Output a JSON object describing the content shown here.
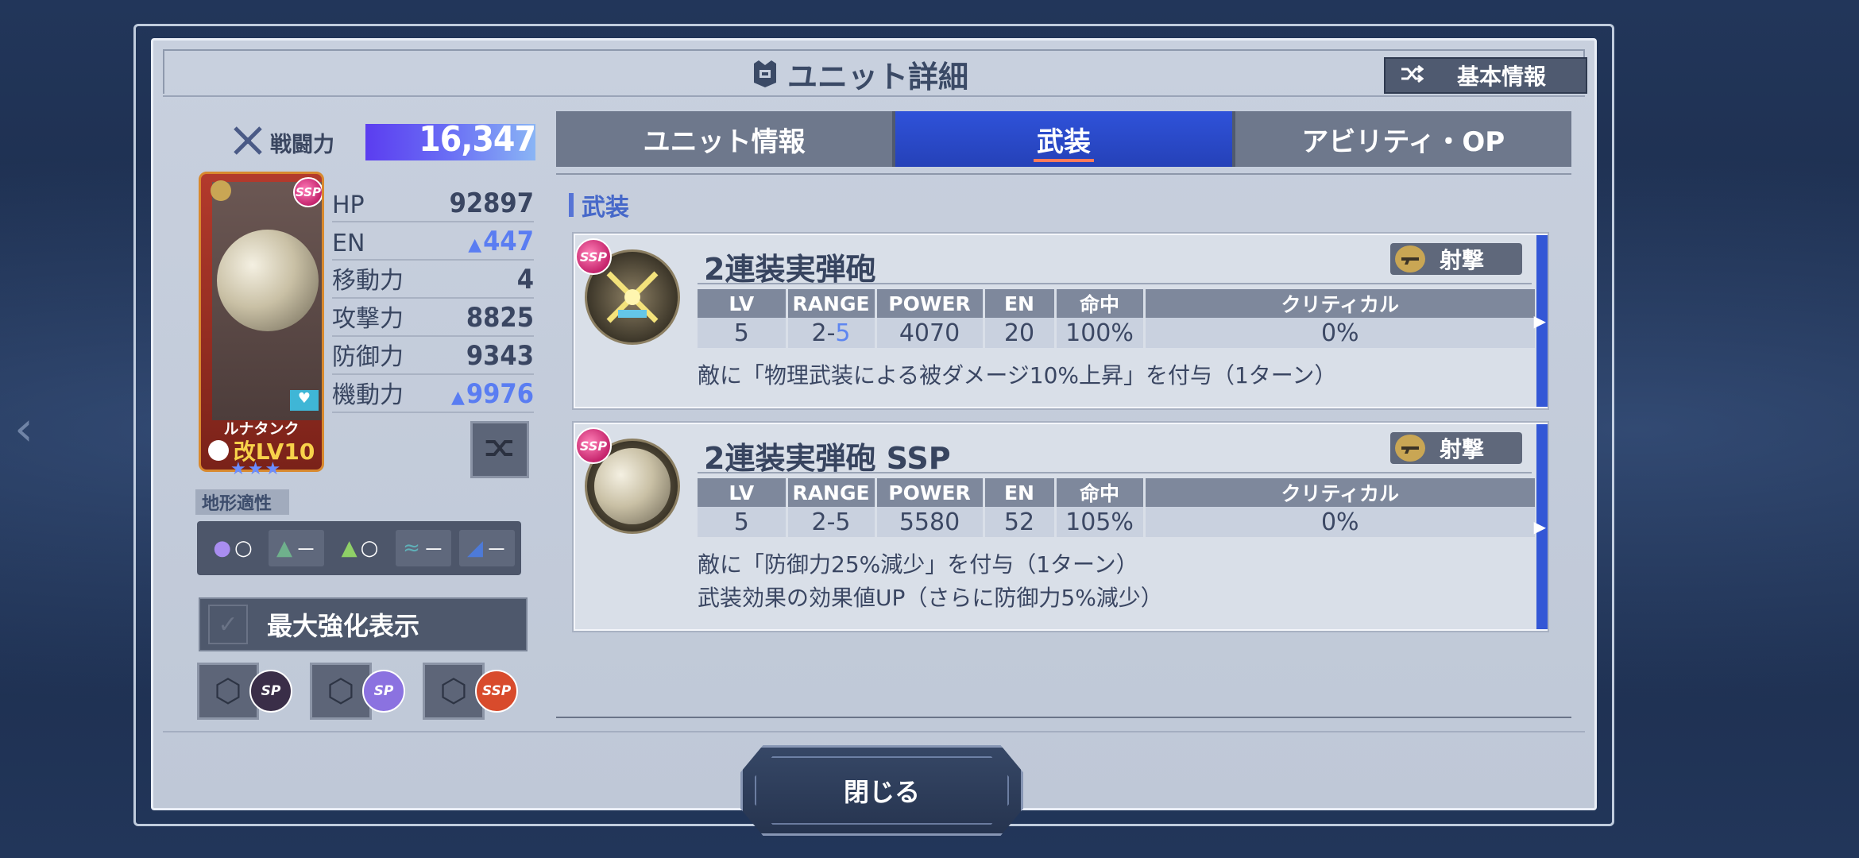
{
  "header": {
    "title": "ユニット詳細",
    "basic_info_label": "基本情報"
  },
  "power": {
    "label": "戦闘力",
    "value": "16,347"
  },
  "unit": {
    "name": "ルナタンク",
    "level": "改LV10",
    "rarity_badge": "SSP",
    "stars": "★★★"
  },
  "stats": [
    {
      "label": "HP",
      "value": "92897",
      "up": false
    },
    {
      "label": "EN",
      "value": "447",
      "up": true
    },
    {
      "label": "移動力",
      "value": "4",
      "up": false
    },
    {
      "label": "攻撃力",
      "value": "8825",
      "up": false
    },
    {
      "label": "防御力",
      "value": "9343",
      "up": false
    },
    {
      "label": "機動力",
      "value": "9976",
      "up": true
    }
  ],
  "terrain": {
    "label": "地形適性",
    "cells": [
      {
        "icon": "space-icon",
        "grade": "○"
      },
      {
        "icon": "air-icon",
        "grade": "－"
      },
      {
        "icon": "ground-icon",
        "grade": "○"
      },
      {
        "icon": "water-icon",
        "grade": "－"
      },
      {
        "icon": "underwater-icon",
        "grade": "－"
      }
    ]
  },
  "max_enhance": {
    "label": "最大強化表示"
  },
  "slots": [
    {
      "badge": "SP"
    },
    {
      "badge": "SP"
    },
    {
      "badge": "SSP"
    }
  ],
  "tabs": [
    {
      "label": "ユニット情報"
    },
    {
      "label": "武装"
    },
    {
      "label": "アビリティ・OP"
    }
  ],
  "section": {
    "title": "武装"
  },
  "table_headers": [
    "LV",
    "RANGE",
    "POWER",
    "EN",
    "命中",
    "クリティカル"
  ],
  "weapons": [
    {
      "badge": "SSP",
      "name": "2連装実弾砲",
      "type": "射撃",
      "lv": "5",
      "range_a": "2-",
      "range_b": "5",
      "power": "4070",
      "en": "20",
      "hit": "100%",
      "crit": "0%",
      "desc1": "敵に「物理武装による被ダメージ10%上昇」を付与（1ターン）",
      "desc2": ""
    },
    {
      "badge": "SSP",
      "name": "2連装実弾砲 SSP",
      "type": "射撃",
      "lv": "5",
      "range_a": "2-5",
      "range_b": "",
      "power": "5580",
      "en": "52",
      "hit": "105%",
      "crit": "0%",
      "desc1": "敵に「防御力25%減少」を付与（1ターン）",
      "desc2": "武装効果の効果値UP（さらに防御力5%減少）"
    }
  ],
  "footer": {
    "close_label": "閉じる"
  },
  "colors": {
    "accent_blue": "#2f52d9",
    "power_gradient_start": "#5b3df0",
    "up_value": "#5a7df2",
    "ssp_pink": "#c4246d"
  }
}
